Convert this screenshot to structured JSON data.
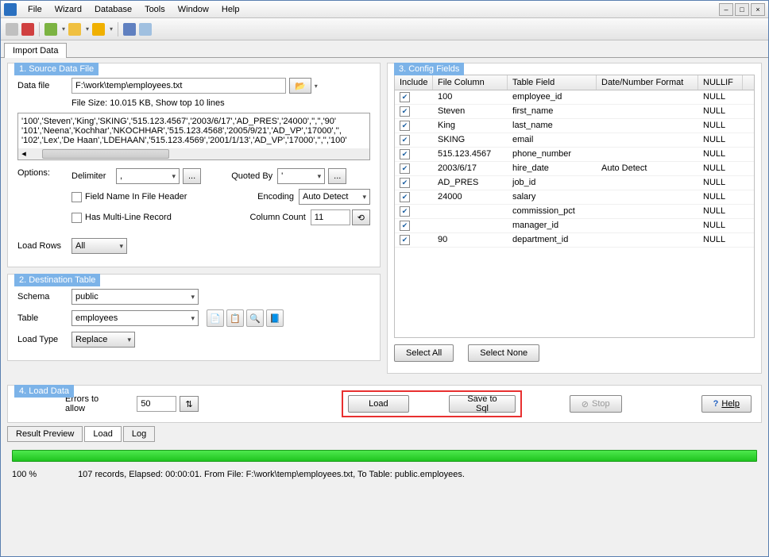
{
  "menu": {
    "items": [
      "File",
      "Wizard",
      "Database",
      "Tools",
      "Window",
      "Help"
    ]
  },
  "tabs": {
    "main": "Import Data"
  },
  "source": {
    "title": "1. Source Data File",
    "dataFileLabel": "Data file",
    "dataFileValue": "F:\\work\\temp\\employees.txt",
    "fileSizeLabel": "File Size: 10.015 KB,   Show top 10 lines",
    "previewLines": [
      "'100','Steven','King','SKING','515.123.4567','2003/6/17','AD_PRES','24000','','','90'",
      "'101','Neena','Kochhar','NKOCHHAR','515.123.4568','2005/9/21','AD_VP','17000','',",
      "'102','Lex','De Haan','LDEHAAN','515.123.4569','2001/1/13','AD_VP','17000','','','100'"
    ],
    "optionsLabel": "Options:",
    "delimiterLabel": "Delimiter",
    "delimiterValue": ",",
    "moreBtn": "...",
    "quotedByLabel": "Quoted By",
    "quotedByValue": "'",
    "fieldNameHeaderLabel": "Field Name In File Header",
    "encodingLabel": "Encoding",
    "encodingValue": "Auto Detect",
    "multiLineLabel": "Has Multi-Line Record",
    "columnCountLabel": "Column Count",
    "columnCountValue": "11",
    "loadRowsLabel": "Load Rows",
    "loadRowsValue": "All"
  },
  "dest": {
    "title": "2. Destination Table",
    "schemaLabel": "Schema",
    "schemaValue": "public",
    "tableLabel": "Table",
    "tableValue": "employees",
    "loadTypeLabel": "Load Type",
    "loadTypeValue": "Replace"
  },
  "config": {
    "title": "3. Config Fields",
    "headers": {
      "include": "Include",
      "fileColumn": "File Column",
      "tableField": "Table Field",
      "dateFormat": "Date/Number Format",
      "nullif": "NULLIF"
    },
    "rows": [
      {
        "fc": "100",
        "tf": "employee_id",
        "df": "",
        "nl": "NULL"
      },
      {
        "fc": "Steven",
        "tf": "first_name",
        "df": "",
        "nl": "NULL"
      },
      {
        "fc": "King",
        "tf": "last_name",
        "df": "",
        "nl": "NULL"
      },
      {
        "fc": "SKING",
        "tf": "email",
        "df": "",
        "nl": "NULL"
      },
      {
        "fc": "515.123.4567",
        "tf": "phone_number",
        "df": "",
        "nl": "NULL"
      },
      {
        "fc": "2003/6/17",
        "tf": "hire_date",
        "df": "Auto Detect",
        "nl": "NULL"
      },
      {
        "fc": "AD_PRES",
        "tf": "job_id",
        "df": "",
        "nl": "NULL"
      },
      {
        "fc": "24000",
        "tf": "salary",
        "df": "",
        "nl": "NULL"
      },
      {
        "fc": "",
        "tf": "commission_pct",
        "df": "",
        "nl": "NULL"
      },
      {
        "fc": "",
        "tf": "manager_id",
        "df": "",
        "nl": "NULL"
      },
      {
        "fc": "90",
        "tf": "department_id",
        "df": "",
        "nl": "NULL"
      }
    ],
    "selectAll": "Select All",
    "selectNone": "Select None"
  },
  "load": {
    "title": "4. Load Data",
    "errorsLabel": "Errors to allow",
    "errorsValue": "50",
    "loadBtn": "Load",
    "saveBtn": "Save to Sql",
    "stopBtn": "Stop",
    "helpBtn": "Help"
  },
  "bottomTabs": {
    "resultPreview": "Result Preview",
    "load": "Load",
    "log": "Log"
  },
  "status": {
    "percent": "100 %",
    "text": "107 records,    Elapsed: 00:00:01.    From File: F:\\work\\temp\\employees.txt,    To Table: public.employees."
  }
}
